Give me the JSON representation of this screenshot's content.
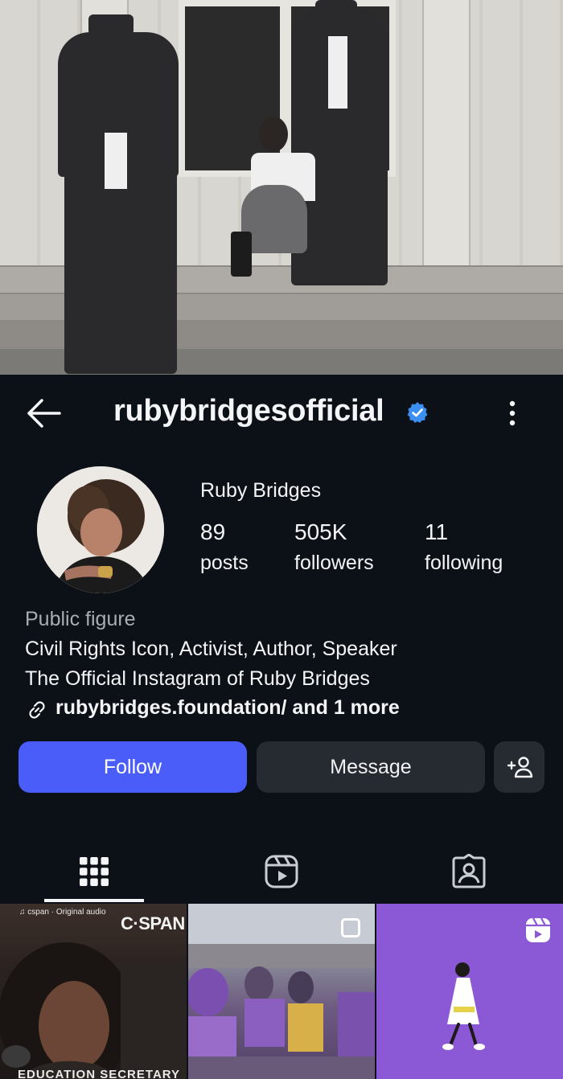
{
  "profile": {
    "username": "rubybridgesofficial",
    "display_name": "Ruby Bridges",
    "stats": [
      {
        "value": "89",
        "label": "posts"
      },
      {
        "value": "505K",
        "label": "followers"
      },
      {
        "value": "11",
        "label": "following"
      }
    ],
    "category": "Public figure",
    "bio": [
      "Civil Rights Icon, Activist, Author, Speaker",
      "The Official Instagram of Ruby Bridges"
    ],
    "link_text": "rubybridges.foundation/ and 1 more"
  },
  "actions": {
    "follow_label": "Follow",
    "message_label": "Message"
  },
  "tabs": [
    "grid-icon",
    "reels-icon",
    "tagged-icon"
  ],
  "posts": [
    {
      "audio": "♫ cspan · Original audio",
      "logo": "C·SPAN",
      "caption": "EDUCATION SECRETARY"
    },
    {
      "type": "carousel"
    },
    {
      "type": "reel"
    }
  ],
  "colors": {
    "background": "#0c1117",
    "follow_button": "#4a5df9",
    "secondary_button": "#262a31",
    "verified_badge": "#3b8ff0",
    "reel_tile": "#8b58d6"
  }
}
